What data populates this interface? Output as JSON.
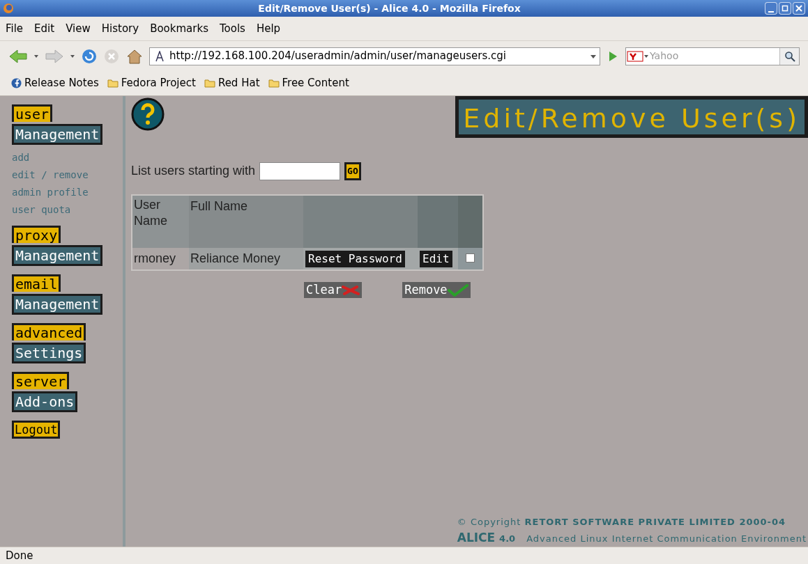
{
  "window": {
    "title": "Edit/Remove User(s) - Alice 4.0 - Mozilla Firefox"
  },
  "menu": [
    "File",
    "Edit",
    "View",
    "History",
    "Bookmarks",
    "Tools",
    "Help"
  ],
  "toolbar": {
    "url": "http://192.168.100.204/useradmin/admin/user/manageusers.cgi",
    "search_placeholder": "Yahoo"
  },
  "bookmarks": [
    {
      "label": "Release Notes",
      "kind": "site"
    },
    {
      "label": "Fedora Project",
      "kind": "folder"
    },
    {
      "label": "Red Hat",
      "kind": "folder"
    },
    {
      "label": "Free Content",
      "kind": "folder"
    }
  ],
  "sidebar": {
    "sections": [
      {
        "top": "user",
        "bottom": "Management",
        "links": [
          "add",
          "edit / remove",
          "admin profile",
          "user quota"
        ]
      },
      {
        "top": "proxy",
        "bottom": "Management"
      },
      {
        "top": "email",
        "bottom": "Management"
      },
      {
        "top": "advanced",
        "bottom": "Settings"
      },
      {
        "top": "server",
        "bottom": "Add-ons"
      }
    ],
    "logout": "Logout"
  },
  "page": {
    "heading": "Edit/Remove User(s)",
    "filter_label": "List users starting with",
    "go": "GO",
    "table": {
      "columns": [
        "User Name",
        "Full Name"
      ],
      "rows": [
        {
          "user": "rmoney",
          "full_name": "Reliance Money",
          "reset": "Reset Password",
          "edit": "Edit",
          "checked": false
        }
      ]
    },
    "buttons": [
      {
        "label": "Clear",
        "kind": "clear"
      },
      {
        "label": "Remove",
        "kind": "remove"
      }
    ],
    "copyright": "© Copyright **RETORT SOFTWARE PRIVATE LIMITED 2000-04**",
    "logo": "ALICE",
    "logo_version": "4.0",
    "tagline": "Advanced Linux Internet Communication Environment"
  },
  "status_bar": "Done"
}
